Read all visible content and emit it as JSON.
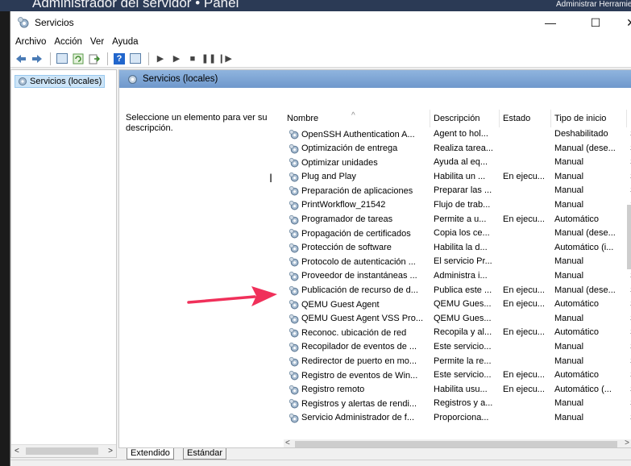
{
  "background": {
    "behind_title": "Administrador del servidor • Panel",
    "behind_right": "Administrar   Herramientas"
  },
  "window": {
    "title": "Servicios",
    "controls": {
      "minimize": "—",
      "maximize": "☐",
      "close": "✕"
    }
  },
  "menu": [
    "Archivo",
    "Acción",
    "Ver",
    "Ayuda"
  ],
  "toolbar": {
    "help_glyph": "?",
    "media_glyphs": [
      "▶",
      "▶",
      "■",
      "❚❚",
      "❙▶"
    ]
  },
  "tree": {
    "item": "Servicios (locales)",
    "scroll_left": "<",
    "scroll_right": ">"
  },
  "pane": {
    "header": "Servicios (locales)",
    "description": "Seleccione un elemento para ver su descripción."
  },
  "list": {
    "columns": [
      "Nombre",
      "Descripción",
      "Estado",
      "Tipo de inicio",
      "In"
    ],
    "sort_glyph": "^",
    "rows": [
      {
        "name": "OpenSSH Authentication A...",
        "desc": "Agent to hol...",
        "estado": "",
        "tipo": "Deshabilitado",
        "in": "Si"
      },
      {
        "name": "Optimización de entrega",
        "desc": "Realiza tarea...",
        "estado": "",
        "tipo": "Manual (dese...",
        "in": "Se"
      },
      {
        "name": "Optimizar unidades",
        "desc": "Ayuda al eq...",
        "estado": "",
        "tipo": "Manual",
        "in": "Si"
      },
      {
        "name": "Plug and Play",
        "desc": "Habilita un ...",
        "estado": "En ejecu...",
        "tipo": "Manual",
        "in": "Si"
      },
      {
        "name": "Preparación de aplicaciones",
        "desc": "Preparar las ...",
        "estado": "",
        "tipo": "Manual",
        "in": "Si"
      },
      {
        "name": "PrintWorkflow_21542",
        "desc": "Flujo de trab...",
        "estado": "",
        "tipo": "Manual",
        "in": "Si"
      },
      {
        "name": "Programador de tareas",
        "desc": "Permite a u...",
        "estado": "En ejecu...",
        "tipo": "Automático",
        "in": "Si"
      },
      {
        "name": "Propagación de certificados",
        "desc": "Copia los ce...",
        "estado": "",
        "tipo": "Manual (dese...",
        "in": "Si"
      },
      {
        "name": "Protección de software",
        "desc": "Habilita la d...",
        "estado": "",
        "tipo": "Automático (i...",
        "in": "Se"
      },
      {
        "name": "Protocolo de autenticación ...",
        "desc": "El servicio Pr...",
        "estado": "",
        "tipo": "Manual",
        "in": "Si"
      },
      {
        "name": "Proveedor de instantáneas ...",
        "desc": "Administra i...",
        "estado": "",
        "tipo": "Manual",
        "in": "Si"
      },
      {
        "name": "Publicación de recurso de d...",
        "desc": "Publica este ...",
        "estado": "En ejecu...",
        "tipo": "Manual (dese...",
        "in": "Se"
      },
      {
        "name": "QEMU Guest Agent",
        "desc": "QEMU Gues...",
        "estado": "En ejecu...",
        "tipo": "Automático",
        "in": "Si"
      },
      {
        "name": "QEMU Guest Agent VSS Pro...",
        "desc": "QEMU Gues...",
        "estado": "",
        "tipo": "Manual",
        "in": "Si"
      },
      {
        "name": "Reconoc. ubicación de red",
        "desc": "Recopila y al...",
        "estado": "En ejecu...",
        "tipo": "Automático",
        "in": "Se"
      },
      {
        "name": "Recopilador de eventos de ...",
        "desc": "Este servicio...",
        "estado": "",
        "tipo": "Manual",
        "in": "Se"
      },
      {
        "name": "Redirector de puerto en mo...",
        "desc": "Permite la re...",
        "estado": "",
        "tipo": "Manual",
        "in": "Si"
      },
      {
        "name": "Registro de eventos de Win...",
        "desc": "Este servicio...",
        "estado": "En ejecu...",
        "tipo": "Automático",
        "in": "Se"
      },
      {
        "name": "Registro remoto",
        "desc": "Habilita usu...",
        "estado": "En ejecu...",
        "tipo": "Automático (...",
        "in": "Se"
      },
      {
        "name": "Registros y alertas de rendi...",
        "desc": "Registros y a...",
        "estado": "",
        "tipo": "Manual",
        "in": "Se"
      },
      {
        "name": "Servicio Administrador de f...",
        "desc": "Proporciona...",
        "estado": "",
        "tipo": "Manual",
        "in": "Si"
      }
    ],
    "scroll_left": "<",
    "scroll_right": ">"
  },
  "tabs": [
    "Extendido",
    "Estándar"
  ],
  "icons": {
    "app": "gear-icon",
    "service": "gear-icon",
    "back": "back-arrow-icon",
    "forward": "forward-arrow-icon",
    "annotation": "red-arrow-icon"
  },
  "colors": {
    "header_blue": "#7aa3d3",
    "selection": "#cce4f7",
    "annotation_arrow": "#f0305a"
  }
}
